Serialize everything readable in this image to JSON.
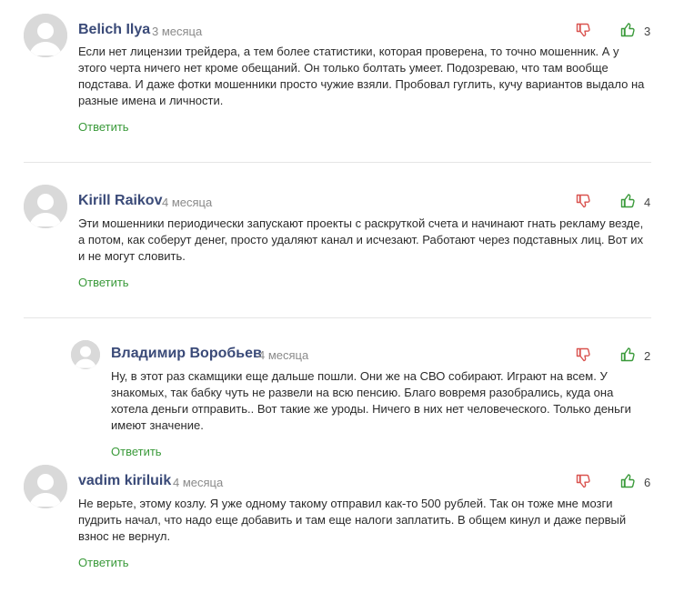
{
  "comments": [
    {
      "author": "Belich Ilya",
      "date": "3 месяца",
      "likes": "3",
      "text": "Если нет лицензии трейдера, а тем более статистики, которая проверена, то точно мошенник. А у этого черта ничего нет кроме обещаний. Он только болтать умеет. Подозреваю, что там вообще подстава. И даже фотки мошенники просто чужие взяли. Пробовал гуглить, кучу вариантов выдало на разные имена и личности.",
      "reply_label": "Ответить"
    },
    {
      "author": "Kirill Raikov",
      "date": "4 месяца",
      "likes": "4",
      "text": "Эти мошенники периодически запускают проекты с раскруткой счета и начинают гнать рекламу везде, а потом, как соберут денег, просто удаляют канал и исчезают. Работают через подставных лиц. Вот их и не могут словить.",
      "reply_label": "Ответить"
    },
    {
      "author": "Владимир Воробьев",
      "date": "4 месяца",
      "likes": "2",
      "text": "Ну, в этот раз скамщики еще дальше пошли. Они же на СВО собирают. Играют на всем. У знакомых, так бабку чуть не развели на всю пенсию. Благо вовремя разобрались, куда она хотела деньги отправить.. Вот такие же уроды. Ничего в них нет человеческого. Только деньги имеют значение.",
      "reply_label": "Ответить"
    },
    {
      "author": "vadim kiriluik",
      "date": "4 месяца",
      "likes": "6",
      "text": "Не верьте, этому козлу. Я уже одному такому отправил как-то 500 рублей. Так он тоже мне мозги пудрить начал, что надо еще добавить и там еще налоги заплатить. В общем кинул и даже первый взнос не вернул.",
      "reply_label": "Ответить"
    }
  ],
  "icons": {
    "avatar": "default-user-avatar-icon",
    "dislike": "thumbs-down-icon",
    "like": "thumbs-up-icon"
  },
  "colors": {
    "author": "#3a4a78",
    "date": "#8a8a8a",
    "reply": "#3a9a3a",
    "like": "#3a9a3a",
    "dislike": "#d9534f",
    "divider": "#e6e6e6"
  }
}
